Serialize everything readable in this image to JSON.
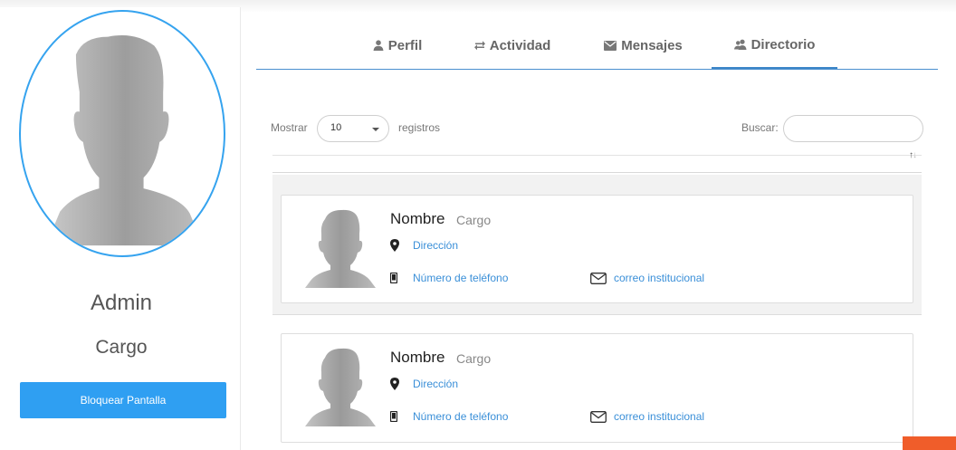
{
  "profile": {
    "name": "Admin",
    "role": "Cargo",
    "lock_button": "Bloquear Pantalla"
  },
  "tabs": [
    {
      "label": "Perfil",
      "icon": "user-icon"
    },
    {
      "label": "Actividad",
      "icon": "exchange-icon"
    },
    {
      "label": "Mensajes",
      "icon": "envelope-icon"
    },
    {
      "label": "Directorio",
      "icon": "users-icon",
      "active": true
    }
  ],
  "table_controls": {
    "show_label": "Mostrar",
    "page_length": "10",
    "records_label": "registros",
    "search_label": "Buscar:",
    "search_value": ""
  },
  "directory": [
    {
      "name": "Nombre",
      "role": "Cargo",
      "address": "Dirección",
      "phone": "Número de teléfono",
      "email": "correo institucional"
    },
    {
      "name": "Nombre",
      "role": "Cargo",
      "address": "Dirección",
      "phone": "Número de teléfono",
      "email": "correo institucional"
    }
  ],
  "colors": {
    "accent": "#2f9ff2",
    "link": "#3a8fd8",
    "avatar_border": "#35a3ef",
    "corner_widget": "#f05d2a"
  }
}
